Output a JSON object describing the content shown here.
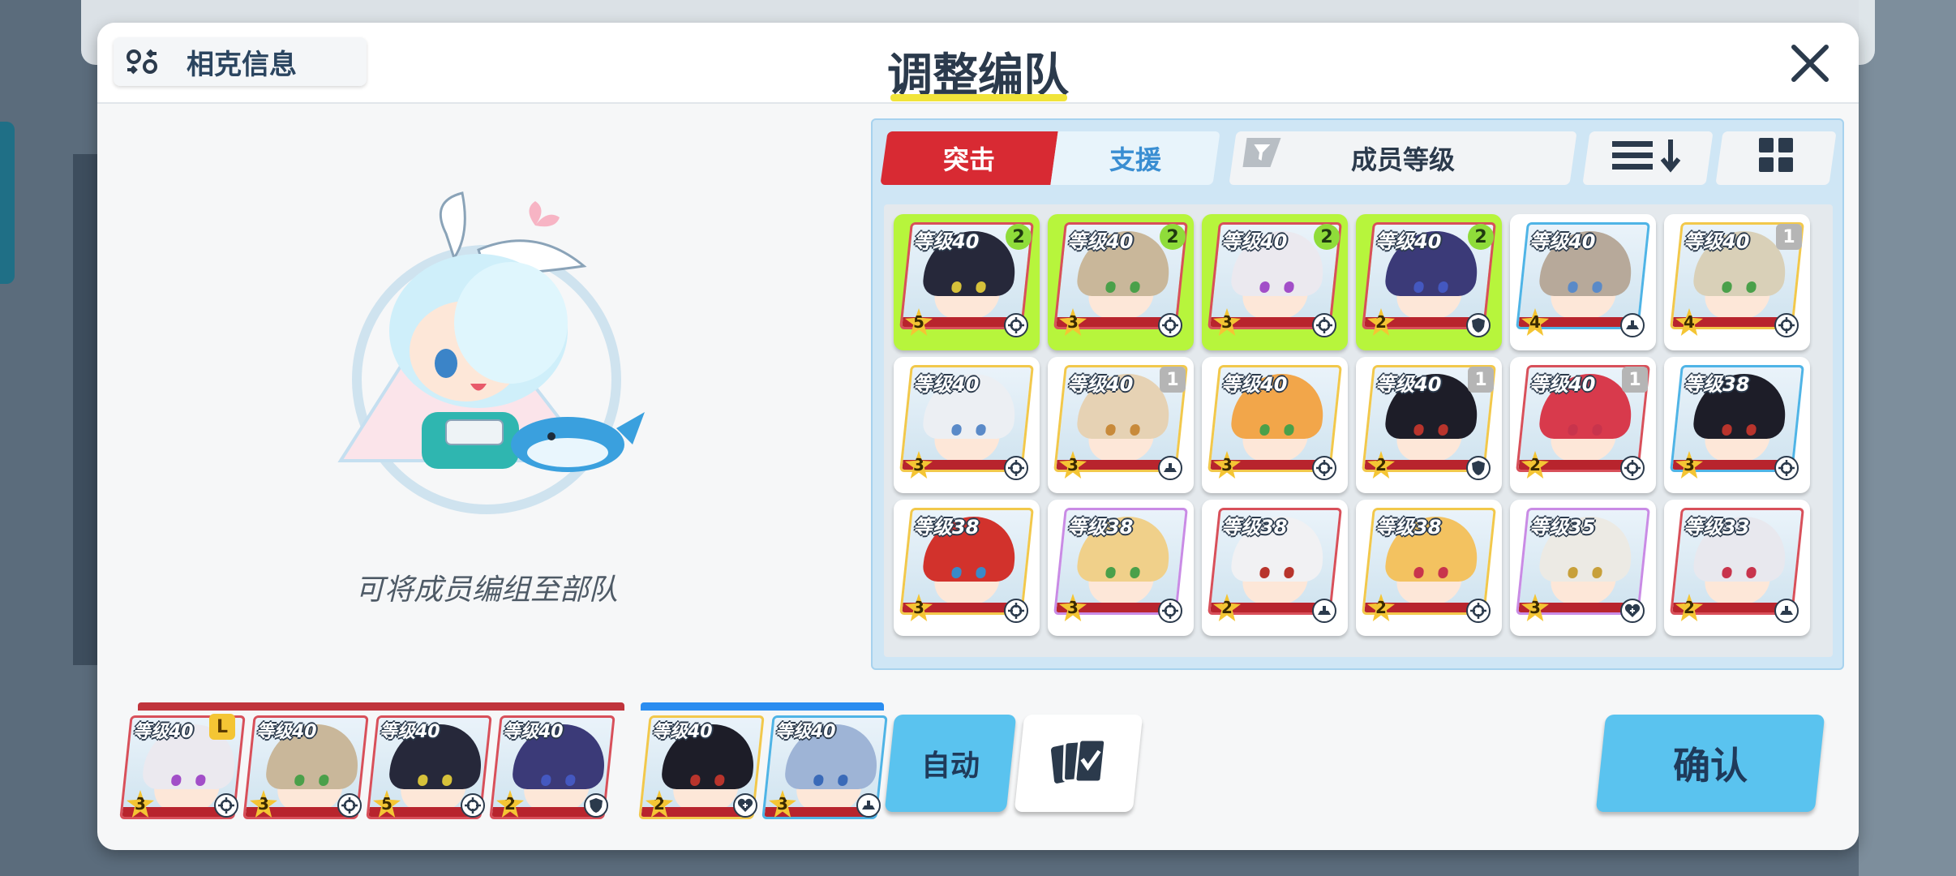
{
  "header": {
    "affinity_label": "相克信息",
    "title": "调整编队"
  },
  "left_panel": {
    "empty_message": "可将成员编组至部队"
  },
  "tabs": {
    "assault": "突击",
    "support": "支援",
    "filter": "成员等级"
  },
  "roster": [
    {
      "level": "等级40",
      "badge": "2",
      "badge_type": "green",
      "stars": "5",
      "role": "crosshair-icon",
      "selected": true,
      "hair": "#26283a",
      "eyes": "#d6c13a",
      "frame": "red"
    },
    {
      "level": "等级40",
      "badge": "2",
      "badge_type": "green",
      "stars": "3",
      "role": "crosshair-icon",
      "selected": true,
      "hair": "#c9b79a",
      "eyes": "#4aa04a",
      "frame": "red"
    },
    {
      "level": "等级40",
      "badge": "2",
      "badge_type": "green",
      "stars": "3",
      "role": "crosshair-icon",
      "selected": true,
      "hair": "#ebe9ef",
      "eyes": "#a24ec8",
      "frame": "red"
    },
    {
      "level": "等级40",
      "badge": "2",
      "badge_type": "green",
      "stars": "2",
      "role": "shield-icon",
      "selected": true,
      "hair": "#3b3a78",
      "eyes": "#4458c0",
      "frame": "red"
    },
    {
      "level": "等级40",
      "badge": "",
      "badge_type": "",
      "stars": "4",
      "role": "tank-icon",
      "selected": false,
      "hair": "#b7a99a",
      "eyes": "#5a8ac8",
      "frame": "blue"
    },
    {
      "level": "等级40",
      "badge": "1",
      "badge_type": "gray",
      "stars": "4",
      "role": "crosshair-icon",
      "selected": false,
      "hair": "#d9d0b8",
      "eyes": "#4aa04a",
      "frame": "gold"
    },
    {
      "level": "等级40",
      "badge": "",
      "badge_type": "",
      "stars": "3",
      "role": "crosshair-icon",
      "selected": false,
      "hair": "#eceff3",
      "eyes": "#5a8ac8",
      "frame": "gold"
    },
    {
      "level": "等级40",
      "badge": "1",
      "badge_type": "gray",
      "stars": "3",
      "role": "tank-icon",
      "selected": false,
      "hair": "#e6d2b4",
      "eyes": "#c88a3a",
      "frame": "gold"
    },
    {
      "level": "等级40",
      "badge": "",
      "badge_type": "",
      "stars": "3",
      "role": "crosshair-icon",
      "selected": false,
      "hair": "#f2a64a",
      "eyes": "#4aa04a",
      "frame": "gold"
    },
    {
      "level": "等级40",
      "badge": "1",
      "badge_type": "gray",
      "stars": "2",
      "role": "shield-icon",
      "selected": false,
      "hair": "#1d1d28",
      "eyes": "#b8342c",
      "frame": "gold"
    },
    {
      "level": "等级40",
      "badge": "1",
      "badge_type": "gray",
      "stars": "2",
      "role": "crosshair-icon",
      "selected": false,
      "hair": "#d83a4c",
      "eyes": "#c8344c",
      "frame": "red"
    },
    {
      "level": "等级38",
      "badge": "",
      "badge_type": "",
      "stars": "3",
      "role": "crosshair-icon",
      "selected": false,
      "hair": "#1d1d28",
      "eyes": "#b8342c",
      "frame": "blue"
    },
    {
      "level": "等级38",
      "badge": "",
      "badge_type": "",
      "stars": "3",
      "role": "crosshair-icon",
      "selected": false,
      "hair": "#d2322c",
      "eyes": "#3a8ac8",
      "frame": "gold"
    },
    {
      "level": "等级38",
      "badge": "",
      "badge_type": "",
      "stars": "3",
      "role": "crosshair-icon",
      "selected": false,
      "hair": "#f0d08a",
      "eyes": "#4aa04a",
      "frame": "purple"
    },
    {
      "level": "等级38",
      "badge": "",
      "badge_type": "",
      "stars": "2",
      "role": "tank-icon",
      "selected": false,
      "hair": "#f1f1f3",
      "eyes": "#b8342c",
      "frame": "red"
    },
    {
      "level": "等级38",
      "badge": "",
      "badge_type": "",
      "stars": "2",
      "role": "crosshair-icon",
      "selected": false,
      "hair": "#f3c260",
      "eyes": "#c8344c",
      "frame": "gold"
    },
    {
      "level": "等级35",
      "badge": "",
      "badge_type": "",
      "stars": "3",
      "role": "heal-icon",
      "selected": false,
      "hair": "#eceae4",
      "eyes": "#c8a03a",
      "frame": "purple"
    },
    {
      "level": "等级33",
      "badge": "",
      "badge_type": "",
      "stars": "2",
      "role": "tank-icon",
      "selected": false,
      "hair": "#e8e8ee",
      "eyes": "#c8344c",
      "frame": "red"
    }
  ],
  "team_main": [
    {
      "level": "等级40",
      "stars": "3",
      "role": "crosshair-icon",
      "leader": "L",
      "hair": "#ebe9ef",
      "eyes": "#a24ec8"
    },
    {
      "level": "等级40",
      "stars": "3",
      "role": "crosshair-icon",
      "leader": "",
      "hair": "#c9b79a",
      "eyes": "#4aa04a"
    },
    {
      "level": "等级40",
      "stars": "5",
      "role": "crosshair-icon",
      "leader": "",
      "hair": "#26283a",
      "eyes": "#d6c13a"
    },
    {
      "level": "等级40",
      "stars": "2",
      "role": "shield-icon",
      "leader": "",
      "hair": "#3b3a78",
      "eyes": "#4458c0"
    }
  ],
  "team_support": [
    {
      "level": "等级40",
      "stars": "2",
      "role": "heal-icon",
      "hair": "#1d1d28",
      "eyes": "#b8342c"
    },
    {
      "level": "等级40",
      "stars": "3",
      "role": "tank-icon",
      "hair": "#9eb4d6",
      "eyes": "#3a6ab8"
    }
  ],
  "buttons": {
    "auto": "自动",
    "confirm": "确认"
  },
  "colors": {
    "assault_red": "#d82a33",
    "support_blue": "#2a8df0",
    "selected_green": "#b7f53c",
    "button_blue": "#5ac3ef"
  }
}
